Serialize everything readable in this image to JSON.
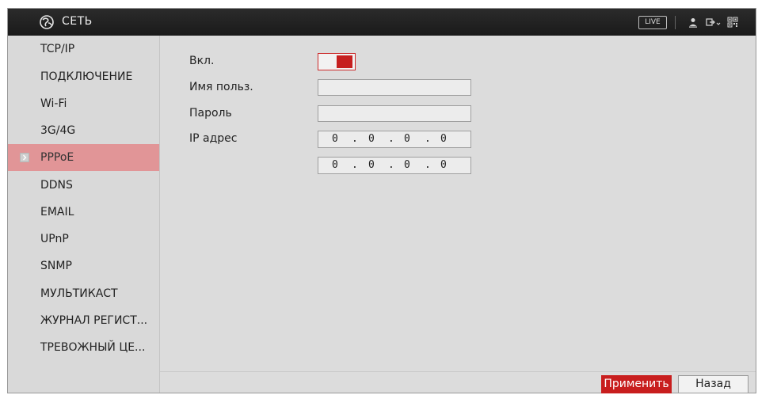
{
  "header": {
    "title": "СЕТЬ",
    "live_label": "LIVE",
    "icons": [
      "globe-logo-icon",
      "user-icon",
      "logout-icon",
      "qr-code-icon"
    ]
  },
  "sidebar": {
    "items": [
      {
        "label": "TCP/IP"
      },
      {
        "label": "ПОДКЛЮЧЕНИЕ"
      },
      {
        "label": "Wi-Fi"
      },
      {
        "label": "3G/4G"
      },
      {
        "label": "PPPoE",
        "active": true
      },
      {
        "label": "DDNS"
      },
      {
        "label": "EMAIL"
      },
      {
        "label": "UPnP"
      },
      {
        "label": "SNMP"
      },
      {
        "label": "МУЛЬТИКАСТ"
      },
      {
        "label": "ЖУРНАЛ РЕГИСТ..."
      },
      {
        "label": "ТРЕВОЖНЫЙ ЦЕ..."
      }
    ]
  },
  "form": {
    "enable_label": "Вкл.",
    "enable_on": true,
    "username_label": "Имя польз.",
    "username_value": "",
    "password_label": "Пароль",
    "password_value": "",
    "ip_label": "IP адрес",
    "ip1": [
      "0",
      "0",
      "0",
      "0"
    ],
    "ip2": [
      "0",
      "0",
      "0",
      "0"
    ],
    "ip_separator": "."
  },
  "buttons": {
    "apply": "Применить",
    "back": "Назад"
  },
  "colors": {
    "accent": "#c81e1e",
    "active_nav": "#e19597",
    "titlebar": "#1f1f1f",
    "panel": "#dcdcdc"
  }
}
